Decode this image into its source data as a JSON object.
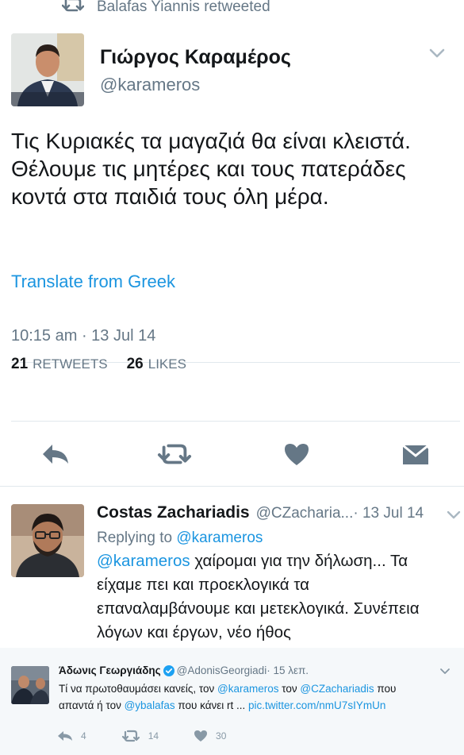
{
  "header": {
    "retweeted_by": "Balafas Yiannis retweeted"
  },
  "main_tweet": {
    "author_name": "Γιώργος Καραμέρος",
    "author_handle": "@karameros",
    "text": "Τις Κυριακές τα μαγαζιά θα είναι κλειστά. Θέλουμε τις μητέρες και τους πατεράδες κοντά στα παιδιά τους όλη μέρα.",
    "translate_label": "Translate from Greek",
    "timestamp": "10:15 am · 13 Jul 14",
    "retweets_count": "21",
    "retweets_label": "RETWEETS",
    "likes_count": "26",
    "likes_label": "LIKES",
    "actions": [
      "reply-icon",
      "retweet-icon",
      "heart-icon",
      "message-icon"
    ]
  },
  "reply_tweet": {
    "author_name": "Costas  Zachariadis",
    "author_handle": "@CZacharia...",
    "date": " · 13 Jul 14",
    "replying_label": "Replying to ",
    "replying_to": "@karameros",
    "mention": "@karameros",
    "text": " χαίρομαι για την δήλωση... Τα είχαμε πει και προεκλογικά τα επαναλαμβάνουμε και μετεκλογικά. Συνέπεια λόγων και έργων, νέο ήθος"
  },
  "embedded_tweet": {
    "author_name": "Άδωνις Γεωργιάδης",
    "author_handle": "@AdonisGeorgiadi",
    "time": " · 15 λεπ.",
    "text_1": "Τί να πρωτοθαυμάσει κανείς, τον ",
    "mention_1": "@karameros",
    "text_2": " τον ",
    "mention_2": "@CZachariadis",
    "text_3": " που απαντά ή τον ",
    "mention_3": "@ybalafas",
    "text_4": " που κάνει rt ... ",
    "link": "pic.twitter.com/nmU7sIYmUn",
    "reply_count": "4",
    "retweet_count": "14",
    "like_count": "30"
  },
  "colors": {
    "accent": "#1b95e0",
    "muted": "#657786",
    "icon": "#657786",
    "divider": "#e1e8ed"
  }
}
